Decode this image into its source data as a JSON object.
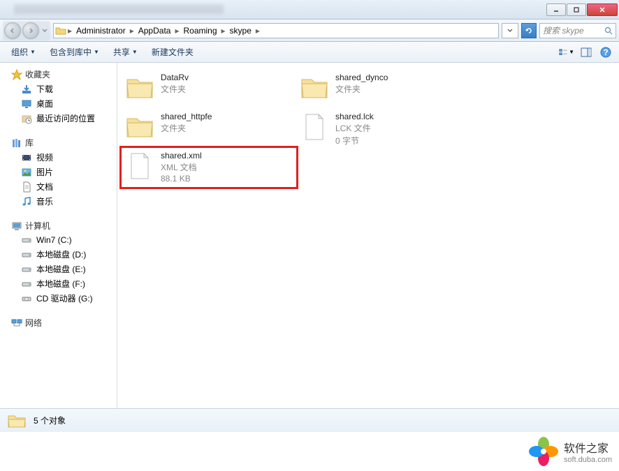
{
  "breadcrumb": [
    "Administrator",
    "AppData",
    "Roaming",
    "skype"
  ],
  "search_placeholder": "搜索 skype",
  "toolbar": {
    "organize": "组织",
    "include": "包含到库中",
    "share": "共享",
    "new_folder": "新建文件夹"
  },
  "sidebar": {
    "favorites": {
      "header": "收藏夹",
      "items": [
        "下载",
        "桌面",
        "最近访问的位置"
      ]
    },
    "libraries": {
      "header": "库",
      "items": [
        "视频",
        "图片",
        "文档",
        "音乐"
      ]
    },
    "computer": {
      "header": "计算机",
      "items": [
        "Win7 (C:)",
        "本地磁盘 (D:)",
        "本地磁盘 (E:)",
        "本地磁盘 (F:)",
        "CD 驱动器 (G:)"
      ]
    },
    "network": {
      "header": "网络"
    }
  },
  "files": [
    {
      "name": "DataRv",
      "type": "文件夹",
      "kind": "folder"
    },
    {
      "name": "shared_dynco",
      "type": "文件夹",
      "kind": "folder"
    },
    {
      "name": "shared_httpfe",
      "type": "文件夹",
      "kind": "folder"
    },
    {
      "name": "shared.lck",
      "type": "LCK 文件",
      "size": "0 字节",
      "kind": "file"
    },
    {
      "name": "shared.xml",
      "type": "XML 文档",
      "size": "88.1 KB",
      "kind": "file",
      "highlighted": true
    }
  ],
  "status": "5 个对象",
  "watermark": {
    "title": "软件之家",
    "url": "soft.duba.com"
  }
}
